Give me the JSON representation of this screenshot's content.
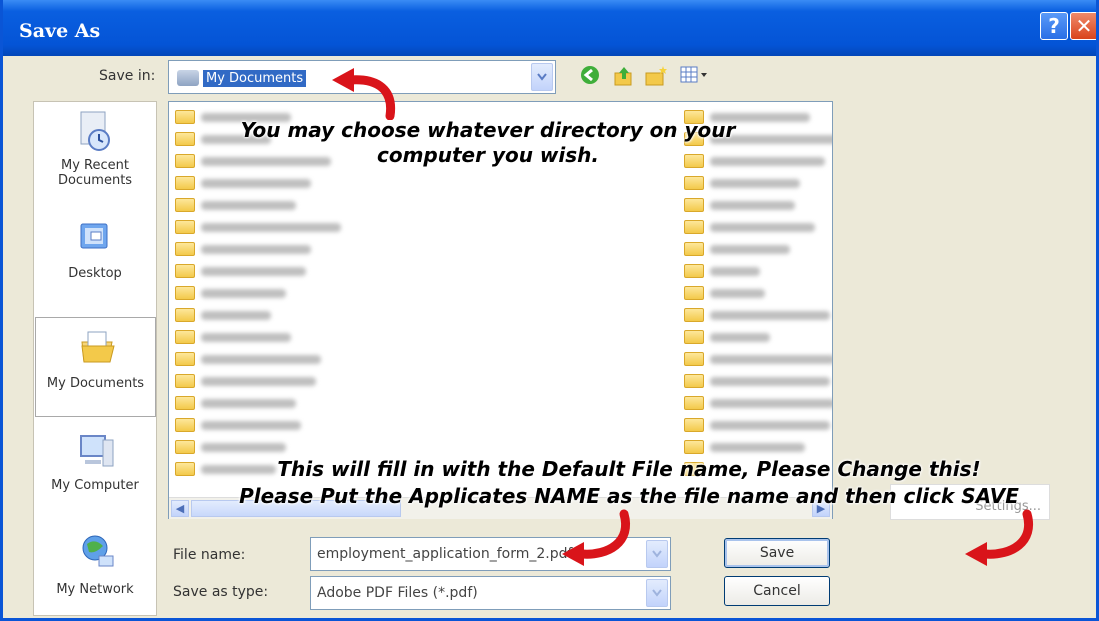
{
  "window": {
    "title": "Save As",
    "help_symbol": "?",
    "close_symbol": "✕"
  },
  "save_in": {
    "label": "Save in:",
    "value": "My Documents"
  },
  "places": [
    {
      "label": "My Recent\nDocuments",
      "icon": "recent-documents-icon"
    },
    {
      "label": "Desktop",
      "icon": "desktop-icon"
    },
    {
      "label": "My Documents",
      "icon": "my-documents-icon",
      "selected": true
    },
    {
      "label": "My Computer",
      "icon": "my-computer-icon"
    },
    {
      "label": "My Network",
      "icon": "my-network-icon"
    }
  ],
  "settings_button": {
    "label": "Settings..."
  },
  "file_name": {
    "label": "File name:",
    "value": "employment_application_form_2.pdf"
  },
  "save_as_type": {
    "label": "Save as type:",
    "value": "Adobe PDF Files (*.pdf)"
  },
  "buttons": {
    "save": "Save",
    "cancel": "Cancel"
  },
  "annotations": {
    "directory_line1": "You may choose whatever directory on your",
    "directory_line2": "computer you wish.",
    "filename_line1": "This will fill in with the Default File name, Please Change this!",
    "filename_line2": "Please Put the Applicates NAME as the file name and then click SAVE"
  },
  "colors": {
    "titlebar": "#0454d6",
    "annotation_arrow": "#d9141a",
    "selection": "#316ac5"
  }
}
